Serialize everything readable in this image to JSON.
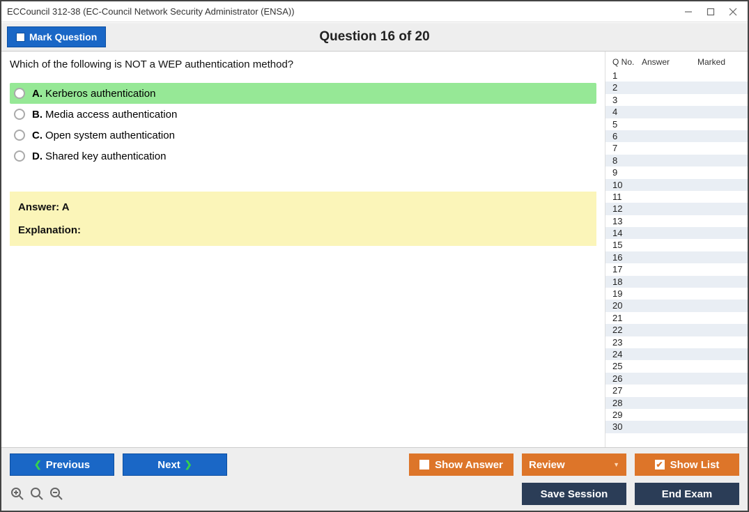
{
  "window": {
    "title": "ECCouncil 312-38 (EC-Council Network Security Administrator (ENSA))"
  },
  "toolbar": {
    "mark_label": "Mark Question",
    "question_header": "Question 16 of 20"
  },
  "question": {
    "text": "Which of the following is NOT a WEP authentication method?",
    "choices": {
      "a": {
        "letter": "A.",
        "text": "Kerberos authentication"
      },
      "b": {
        "letter": "B.",
        "text": "Media access authentication"
      },
      "c": {
        "letter": "C.",
        "text": "Open system authentication"
      },
      "d": {
        "letter": "D.",
        "text": "Shared key authentication"
      }
    },
    "answer_line": "Answer: A",
    "explanation_label": "Explanation:"
  },
  "sidebar": {
    "h_qno": "Q No.",
    "h_answer": "Answer",
    "h_marked": "Marked",
    "rows": [
      "1",
      "2",
      "3",
      "4",
      "5",
      "6",
      "7",
      "8",
      "9",
      "10",
      "11",
      "12",
      "13",
      "14",
      "15",
      "16",
      "17",
      "18",
      "19",
      "20",
      "21",
      "22",
      "23",
      "24",
      "25",
      "26",
      "27",
      "28",
      "29",
      "30"
    ]
  },
  "footer": {
    "previous": "Previous",
    "next": "Next",
    "show_answer": "Show Answer",
    "review": "Review",
    "show_list": "Show List",
    "save_session": "Save Session",
    "end_exam": "End Exam"
  }
}
